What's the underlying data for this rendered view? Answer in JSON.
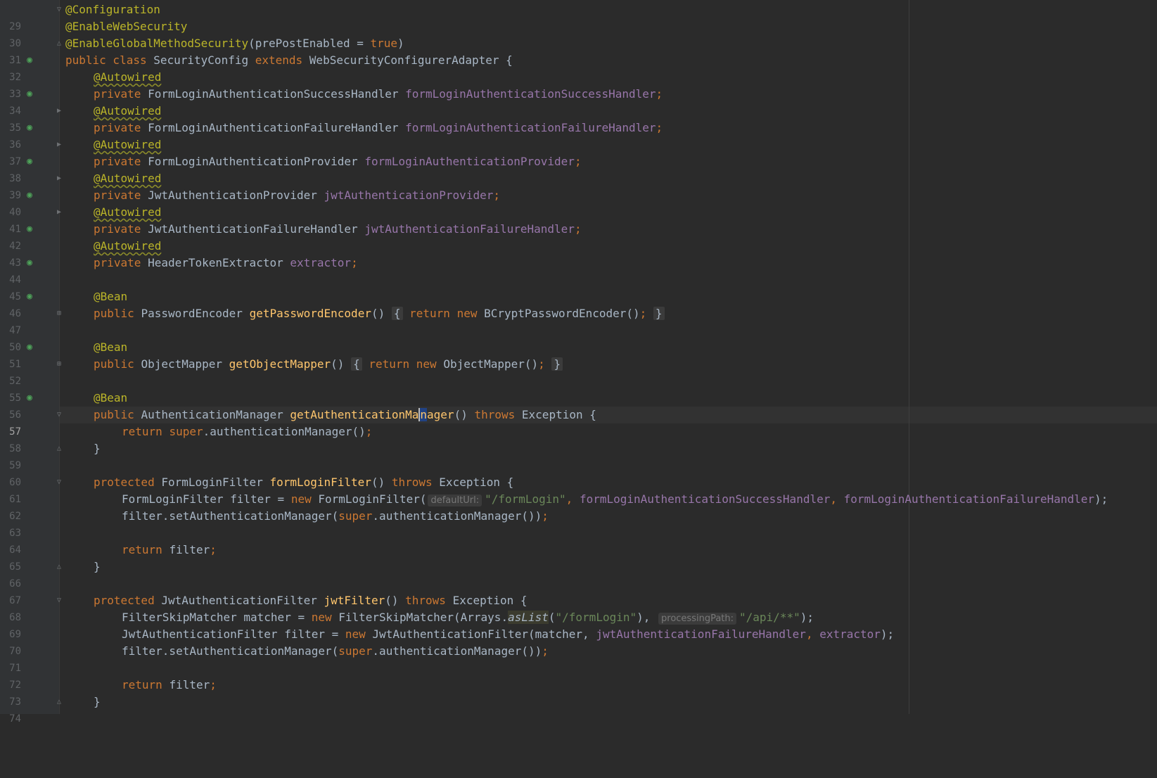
{
  "editor": {
    "current_line": "57",
    "lines": [
      {
        "n": "29"
      },
      {
        "n": "30"
      },
      {
        "n": "31"
      },
      {
        "n": "32"
      },
      {
        "n": "33"
      },
      {
        "n": "34"
      },
      {
        "n": "35"
      },
      {
        "n": "36"
      },
      {
        "n": "37"
      },
      {
        "n": "38"
      },
      {
        "n": "39"
      },
      {
        "n": "40"
      },
      {
        "n": "41"
      },
      {
        "n": "42"
      },
      {
        "n": "43"
      },
      {
        "n": "44"
      },
      {
        "n": "45"
      },
      {
        "n": "46"
      },
      {
        "n": "47"
      },
      {
        "n": "50"
      },
      {
        "n": "51"
      },
      {
        "n": "52"
      },
      {
        "n": "55"
      },
      {
        "n": "56"
      },
      {
        "n": "57"
      },
      {
        "n": "58"
      },
      {
        "n": "59"
      },
      {
        "n": "60"
      },
      {
        "n": "61"
      },
      {
        "n": "62"
      },
      {
        "n": "63"
      },
      {
        "n": "64"
      },
      {
        "n": "65"
      },
      {
        "n": "66"
      },
      {
        "n": "67"
      },
      {
        "n": "68"
      },
      {
        "n": "69"
      },
      {
        "n": "70"
      },
      {
        "n": "71"
      },
      {
        "n": "72"
      },
      {
        "n": "73"
      },
      {
        "n": "74"
      }
    ],
    "code": {
      "l29": [
        "@Configuration"
      ],
      "l30": [
        "@EnableWebSecurity"
      ],
      "l31": [
        "@EnableGlobalMethodSecurity",
        "(prePostEnabled = ",
        "true",
        ")"
      ],
      "l32": [
        "public class ",
        "SecurityConfig ",
        "extends ",
        "WebSecurityConfigurerAdapter {"
      ],
      "l33": [
        "@Autowired"
      ],
      "l34": [
        "private ",
        "FormLoginAuthenticationSuccessHandler ",
        "formLoginAuthenticationSuccessHandler",
        ";"
      ],
      "l35": [
        "@Autowired"
      ],
      "l36": [
        "private ",
        "FormLoginAuthenticationFailureHandler ",
        "formLoginAuthenticationFailureHandler",
        ";"
      ],
      "l37": [
        "@Autowired"
      ],
      "l38": [
        "private ",
        "FormLoginAuthenticationProvider ",
        "formLoginAuthenticationProvider",
        ";"
      ],
      "l39": [
        "@Autowired"
      ],
      "l40": [
        "private ",
        "JwtAuthenticationProvider ",
        "jwtAuthenticationProvider",
        ";"
      ],
      "l41": [
        "@Autowired"
      ],
      "l42": [
        "private ",
        "JwtAuthenticationFailureHandler ",
        "jwtAuthenticationFailureHandler",
        ";"
      ],
      "l43": [
        "@Autowired"
      ],
      "l44": [
        "private ",
        "HeaderTokenExtractor ",
        "extractor",
        ";"
      ],
      "l46": [
        "@Bean"
      ],
      "l47": [
        "public ",
        "PasswordEncoder ",
        "getPasswordEncoder",
        "() ",
        "{",
        " return new ",
        "BCryptPasswordEncoder()",
        "; ",
        "}"
      ],
      "l51": [
        "@Bean"
      ],
      "l52": [
        "public ",
        "ObjectMapper ",
        "getObjectMapper",
        "() ",
        "{",
        " return new ",
        "ObjectMapper()",
        "; ",
        "}"
      ],
      "l56": [
        "@Bean"
      ],
      "l57": [
        "public ",
        "AuthenticationManager ",
        "getAuthenticationMa",
        "n",
        "ager",
        "() ",
        "throws ",
        "Exception {"
      ],
      "l58": [
        "return ",
        "super",
        ".authenticationManager()",
        ";"
      ],
      "l59": [
        "}"
      ],
      "l61": [
        "protected ",
        "FormLoginFilter ",
        "formLoginFilter",
        "() ",
        "throws ",
        "Exception {"
      ],
      "l62": [
        "FormLoginFilter filter = ",
        "new ",
        "FormLoginFilter(",
        "defaultUrl:",
        "\"/formLogin\"",
        ", ",
        "formLoginAuthenticationSuccessHandler",
        ", ",
        "formLoginAuthenticationFailureHandler",
        ");"
      ],
      "l63": [
        "filter.setAuthenticationManager(",
        "super",
        ".authenticationManager())",
        ";"
      ],
      "l65": [
        "return ",
        "filter",
        ";"
      ],
      "l66": [
        "}"
      ],
      "l68": [
        "protected ",
        "JwtAuthenticationFilter ",
        "jwtFilter",
        "() ",
        "throws ",
        "Exception {"
      ],
      "l69": [
        "FilterSkipMatcher matcher = ",
        "new ",
        "FilterSkipMatcher(Arrays.",
        "asList",
        "(",
        "\"/formLogin\"",
        "), ",
        "processingPath:",
        "\"/api/**\"",
        ");"
      ],
      "l70": [
        "JwtAuthenticationFilter filter = ",
        "new ",
        "JwtAuthenticationFilter(matcher, ",
        "jwtAuthenticationFailureHandler",
        ", ",
        "extractor",
        ");"
      ],
      "l71": [
        "filter.setAuthenticationManager(",
        "super",
        ".authenticationManager())",
        ";"
      ],
      "l73": [
        "return ",
        "filter",
        ";"
      ],
      "l74": [
        "}"
      ]
    }
  },
  "gutter_icons": {
    "class_icon": "class-override-icon",
    "field_icon": "autowired-bean-icon",
    "bean_icon": "bean-method-icon",
    "fold_open": "fold-open-icon",
    "fold_closed": "fold-collapsed-icon"
  },
  "colors": {
    "background": "#2b2b2b",
    "gutter": "#313335",
    "keyword": "#cc7832",
    "annotation": "#bbb529",
    "field": "#9876aa",
    "method": "#ffc66d",
    "string": "#6a8759",
    "text": "#a9b7c6"
  }
}
